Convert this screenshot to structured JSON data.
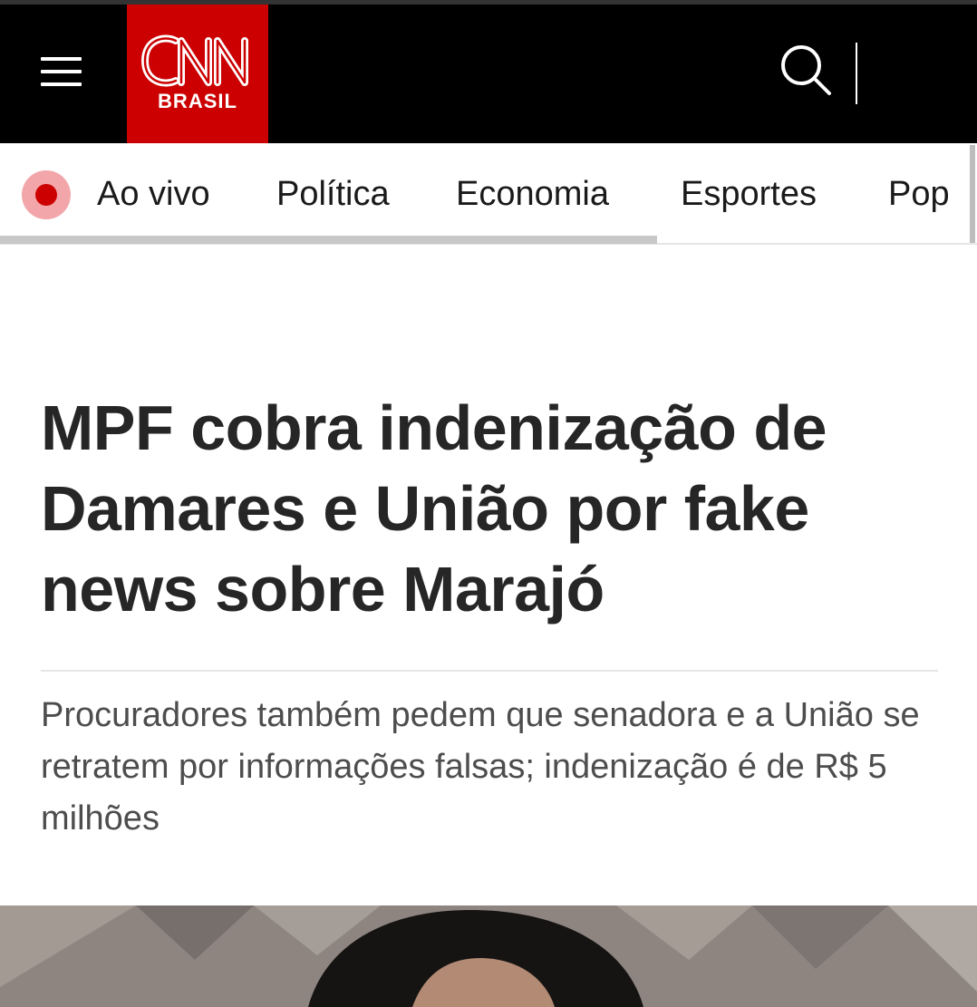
{
  "header": {
    "logo": {
      "main_text": "CNN",
      "sub_text": "BRASIL",
      "brand_color": "#cc0000"
    },
    "menu_icon": "hamburger-menu-icon",
    "search_icon": "search-icon"
  },
  "nav": {
    "live_label": "Ao vivo",
    "live_color": "#cc0000",
    "items": [
      {
        "label": "Política"
      },
      {
        "label": "Economia"
      },
      {
        "label": "Esportes"
      },
      {
        "label": "Pop"
      }
    ]
  },
  "article": {
    "headline": "MPF cobra indenização de Damares e União por fake news sobre Marajó",
    "dek": "Procuradores também pedem que senadora e a União se retratem por informações falsas; indenização é de R$ 5 milhões"
  }
}
